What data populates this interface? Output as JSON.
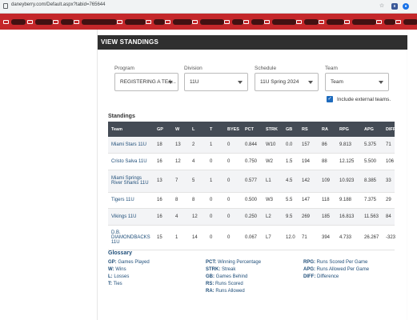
{
  "browser": {
    "url": "daneyberry.com/Default.aspx?tabid=765644"
  },
  "card": {
    "title": "VIEW STANDINGS"
  },
  "filters": {
    "program": {
      "label": "Program",
      "value": "REGISTERING A TEA..."
    },
    "division": {
      "label": "Division",
      "value": "11U"
    },
    "schedule": {
      "label": "Schedule",
      "value": "11U Spring 2024"
    },
    "team": {
      "label": "Team",
      "value": "Team"
    },
    "include_external_label": "Include external teams."
  },
  "standings": {
    "title": "Standings",
    "columns": [
      "Team",
      "GP",
      "W",
      "L",
      "T",
      "BYES",
      "PCT",
      "STRK",
      "GB",
      "RS",
      "RA",
      "RPG",
      "APG",
      "DIFF"
    ],
    "rows": [
      [
        "Miami Stars 11U",
        "18",
        "13",
        "2",
        "1",
        "0",
        "0.844",
        "W10",
        "0.0",
        "157",
        "86",
        "9.813",
        "5.375",
        "71"
      ],
      [
        "Cristo Salva 11U",
        "16",
        "12",
        "4",
        "0",
        "0",
        "0.750",
        "W2",
        "1.5",
        "194",
        "88",
        "12.125",
        "5.500",
        "106"
      ],
      [
        "Miami Springs River Sharks 11U",
        "13",
        "7",
        "5",
        "1",
        "0",
        "0.577",
        "L1",
        "4.5",
        "142",
        "109",
        "10.923",
        "8.385",
        "33"
      ],
      [
        "Tigers 11U",
        "16",
        "8",
        "8",
        "0",
        "0",
        "0.500",
        "W3",
        "5.5",
        "147",
        "118",
        "9.188",
        "7.375",
        "29"
      ],
      [
        "Vikings 11U",
        "16",
        "4",
        "12",
        "0",
        "0",
        "0.250",
        "L2",
        "9.5",
        "269",
        "185",
        "16.813",
        "11.563",
        "84"
      ],
      [
        "D.B. DIAMONDBACKS 11U",
        "15",
        "1",
        "14",
        "0",
        "0",
        "0.067",
        "L7",
        "12.0",
        "71",
        "394",
        "4.733",
        "26.267",
        "-323"
      ]
    ]
  },
  "glossary": {
    "title": "Glossary",
    "col1": [
      {
        "term": "GP:",
        "desc": "Games Played"
      },
      {
        "term": "W:",
        "desc": "Wins"
      },
      {
        "term": "L:",
        "desc": "Losses"
      },
      {
        "term": "T:",
        "desc": "Ties"
      }
    ],
    "col2": [
      {
        "term": "PCT:",
        "desc": "Winning Percentage"
      },
      {
        "term": "STRK:",
        "desc": "Streak"
      },
      {
        "term": "GB:",
        "desc": "Games Behind"
      },
      {
        "term": "RS:",
        "desc": "Runs Scored"
      },
      {
        "term": "RA:",
        "desc": "Runs Allowed"
      }
    ],
    "col3": [
      {
        "term": "RPG:",
        "desc": "Runs Scored Per Game"
      },
      {
        "term": "APG:",
        "desc": "Runs Allowed Per Game"
      },
      {
        "term": "DIFF:",
        "desc": "Difference"
      }
    ]
  }
}
